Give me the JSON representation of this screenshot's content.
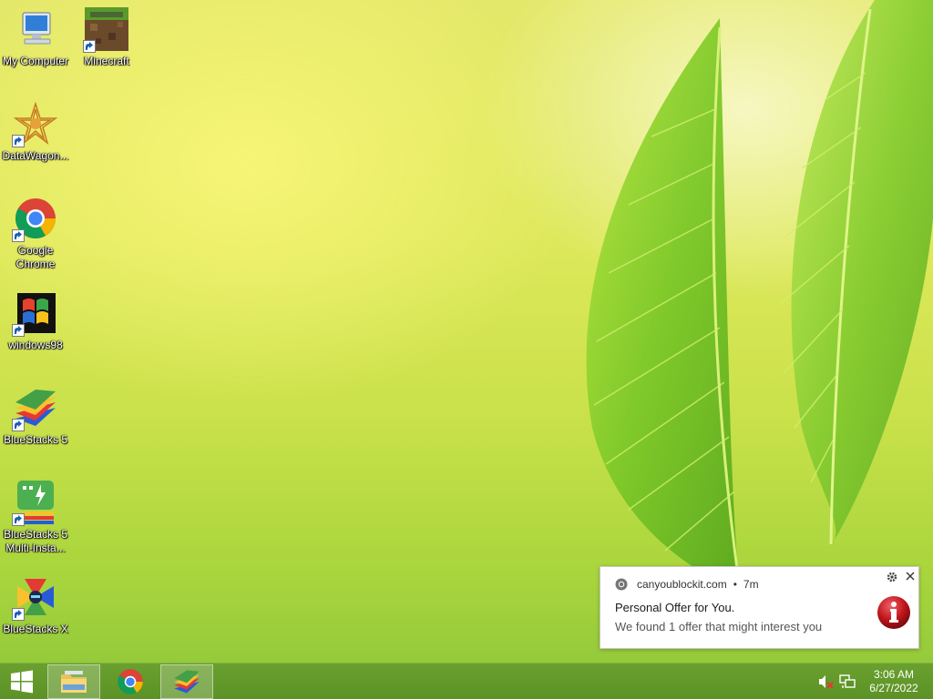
{
  "desktop": {
    "icons": [
      {
        "label": "My Computer",
        "icon": "my-computer-icon"
      },
      {
        "label": "Minecraft",
        "icon": "minecraft-icon"
      },
      {
        "label": "DataWagon...",
        "icon": "datawagon-icon"
      },
      {
        "label": "Google Chrome",
        "icon": "chrome-icon"
      },
      {
        "label": "windows98",
        "icon": "windows98-icon"
      },
      {
        "label": "BlueStacks 5",
        "icon": "bluestacks-icon"
      },
      {
        "label": "BlueStacks 5 Multi-Insta...",
        "icon": "bluestacks-multi-instance-icon"
      },
      {
        "label": "BlueStacks X",
        "icon": "bluestacks-x-icon"
      }
    ]
  },
  "notification": {
    "source": "canyoublockit.com",
    "separator": "•",
    "age": "7m",
    "title": "Personal Offer for You.",
    "body": "We found 1 offer that might interest you",
    "icons": [
      "chrome-small-icon",
      "gear-icon",
      "close-icon",
      "info-icon"
    ]
  },
  "taskbar": {
    "buttons": [
      "start-icon",
      "file-explorer-icon",
      "chrome-icon",
      "bluestacks-icon"
    ],
    "tray": [
      "volume-muted-icon",
      "network-icon"
    ],
    "clock": {
      "time": "3:06 AM",
      "date": "6/27/2022"
    }
  },
  "colors": {
    "taskbar": "#5c9226",
    "toast_background": "#ffffff",
    "info_red": "#c0161a"
  }
}
